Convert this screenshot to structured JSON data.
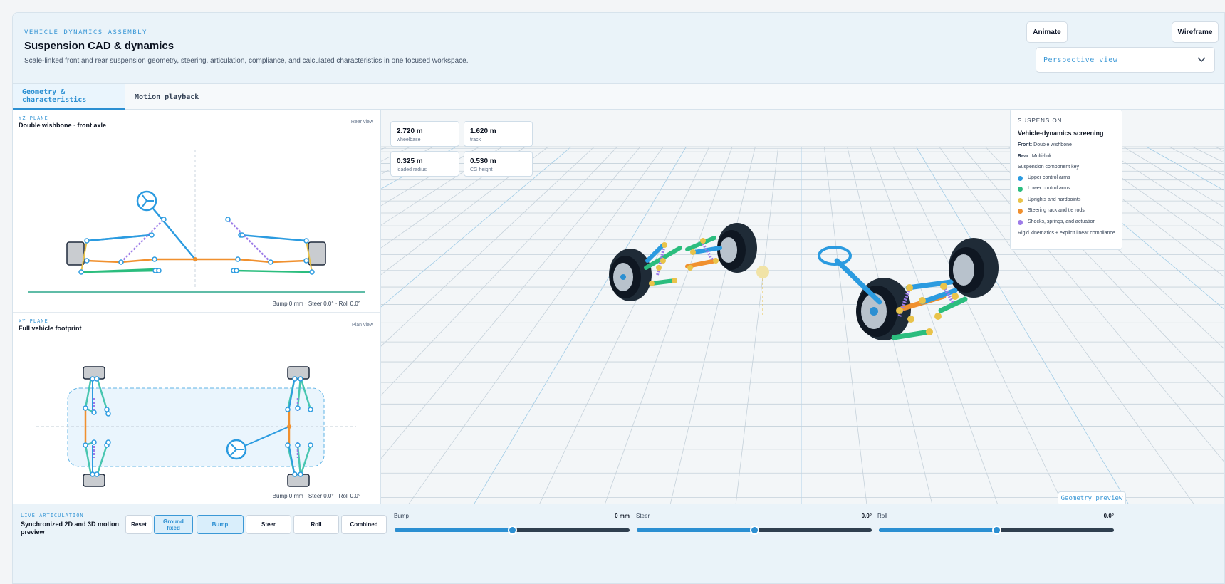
{
  "header": {
    "eyebrow": "VEHICLE DYNAMICS ASSEMBLY",
    "title": "Suspension CAD & dynamics",
    "subtitle": "Scale-linked front and rear suspension geometry, steering, articulation, compliance, and calculated characteristics in one focused workspace.",
    "animate_label": "Animate",
    "wireframe_label": "Wireframe",
    "view_select": "Perspective view"
  },
  "tabs": [
    {
      "label": "Geometry & characteristics",
      "active": true
    },
    {
      "label": "Motion playback",
      "active": false
    }
  ],
  "yz_panel": {
    "plane": "YZ PLANE",
    "title": "Double wishbone · front axle",
    "view": "Rear view",
    "status": "Bump 0 mm · Steer 0.0° · Roll 0.0°"
  },
  "xy_panel": {
    "plane": "XY PLANE",
    "title": "Full vehicle footprint",
    "view": "Plan view",
    "status": "Bump 0 mm · Steer 0.0° · Roll 0.0°"
  },
  "metrics": [
    {
      "value": "2.720 m",
      "label": "wheelbase"
    },
    {
      "value": "1.620 m",
      "label": "track"
    },
    {
      "value": "0.325 m",
      "label": "loaded radius"
    },
    {
      "value": "0.530 m",
      "label": "CG height"
    }
  ],
  "legend": {
    "section": "SUSPENSION",
    "title": "Vehicle-dynamics screening",
    "front_key": "Front:",
    "front_val": "Double wishbone",
    "rear_key": "Rear:",
    "rear_val": "Multi-link",
    "key_title": "Suspension component key",
    "items": [
      {
        "label": "Upper control arms",
        "color": "#2b9be0"
      },
      {
        "label": "Lower control arms",
        "color": "#2bbd7e"
      },
      {
        "label": "Uprights and hardpoints",
        "color": "#e9c34a"
      },
      {
        "label": "Steering rack and tie rods",
        "color": "#f0902e"
      },
      {
        "label": "Shocks, springs, and actuation",
        "color": "#9d7be8"
      }
    ],
    "note": "Rigid kinematics + explicit linear compliance"
  },
  "geometry_preview_label": "Geometry preview",
  "live": {
    "eyebrow": "LIVE ARTICULATION",
    "title": "Synchronized 2D and 3D motion preview",
    "buttons": [
      {
        "label": "Reset",
        "active": false
      },
      {
        "label": "Ground fixed",
        "active": true
      },
      {
        "label": "Bump",
        "active": true
      },
      {
        "label": "Steer",
        "active": false
      },
      {
        "label": "Roll",
        "active": false
      },
      {
        "label": "Combined",
        "active": false
      }
    ],
    "sliders": [
      {
        "label": "Bump",
        "value": "0 mm",
        "position": 0.5
      },
      {
        "label": "Steer",
        "value": "0.0°",
        "position": 0.5
      },
      {
        "label": "Roll",
        "value": "0.0°",
        "position": 0.5
      }
    ]
  },
  "colors": {
    "accent": "#2b8fd2",
    "upper_arm": "#2b9be0",
    "lower_arm": "#2bbd7e",
    "upright": "#e9c34a",
    "steering": "#f0902e",
    "shock": "#9d7be8"
  }
}
